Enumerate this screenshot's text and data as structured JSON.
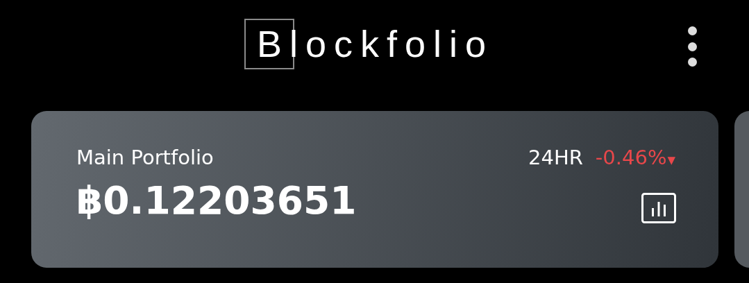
{
  "header": {
    "logo": "Blockfolio"
  },
  "portfolio_card": {
    "name": "Main Portfolio",
    "period": "24HR",
    "change": "-0.46%",
    "arrow": "▼",
    "balance": "฿0.12203651"
  }
}
